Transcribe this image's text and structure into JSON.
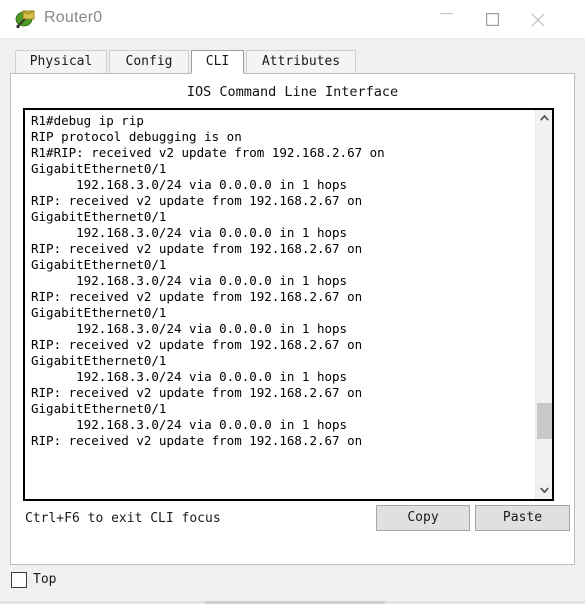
{
  "window": {
    "title": "Router0",
    "icon": "router-icon",
    "controls": {
      "minimize": "minimize-icon",
      "maximize": "maximize-icon",
      "close": "close-icon"
    }
  },
  "tabs": [
    {
      "label": "Physical",
      "active": false
    },
    {
      "label": "Config",
      "active": false
    },
    {
      "label": "CLI",
      "active": true
    },
    {
      "label": "Attributes",
      "active": false
    }
  ],
  "panel": {
    "header": "IOS Command Line Interface"
  },
  "terminal": {
    "lines": [
      "R1#debug ip rip",
      "RIP protocol debugging is on",
      "R1#RIP: received v2 update from 192.168.2.67 on",
      "GigabitEthernet0/1",
      "      192.168.3.0/24 via 0.0.0.0 in 1 hops",
      "RIP: received v2 update from 192.168.2.67 on",
      "GigabitEthernet0/1",
      "      192.168.3.0/24 via 0.0.0.0 in 1 hops",
      "RIP: received v2 update from 192.168.2.67 on",
      "GigabitEthernet0/1",
      "      192.168.3.0/24 via 0.0.0.0 in 1 hops",
      "RIP: received v2 update from 192.168.2.67 on",
      "GigabitEthernet0/1",
      "      192.168.3.0/24 via 0.0.0.0 in 1 hops",
      "RIP: received v2 update from 192.168.2.67 on",
      "GigabitEthernet0/1",
      "      192.168.3.0/24 via 0.0.0.0 in 1 hops",
      "RIP: received v2 update from 192.168.2.67 on",
      "GigabitEthernet0/1",
      "      192.168.3.0/24 via 0.0.0.0 in 1 hops",
      "RIP: received v2 update from 192.168.2.67 on"
    ],
    "text": "R1#debug ip rip\nRIP protocol debugging is on\nR1#RIP: received v2 update from 192.168.2.67 on\nGigabitEthernet0/1\n      192.168.3.0/24 via 0.0.0.0 in 1 hops\nRIP: received v2 update from 192.168.2.67 on\nGigabitEthernet0/1\n      192.168.3.0/24 via 0.0.0.0 in 1 hops\nRIP: received v2 update from 192.168.2.67 on\nGigabitEthernet0/1\n      192.168.3.0/24 via 0.0.0.0 in 1 hops\nRIP: received v2 update from 192.168.2.67 on\nGigabitEthernet0/1\n      192.168.3.0/24 via 0.0.0.0 in 1 hops\nRIP: received v2 update from 192.168.2.67 on\nGigabitEthernet0/1\n      192.168.3.0/24 via 0.0.0.0 in 1 hops\nRIP: received v2 update from 192.168.2.67 on\nGigabitEthernet0/1\n      192.168.3.0/24 via 0.0.0.0 in 1 hops\nRIP: received v2 update from 192.168.2.67 on"
  },
  "scrollbar": {
    "up_arrow": "chevron-up-icon",
    "down_arrow": "chevron-down-icon"
  },
  "footer": {
    "hint": "Ctrl+F6 to exit CLI focus",
    "copy_label": "Copy",
    "paste_label": "Paste"
  },
  "top_option": {
    "label": "Top",
    "checked": false
  },
  "colors": {
    "titlebar_bg": "#ffffff",
    "window_bg": "#f0f0f0",
    "panel_bg": "#ffffff",
    "terminal_text": "#000000",
    "button_bg": "#e0e0e0",
    "scroll_thumb": "#c9c9c9",
    "active_tab_bg": "#ffffff",
    "inactive_tab_bg": "#f4f4f4"
  }
}
